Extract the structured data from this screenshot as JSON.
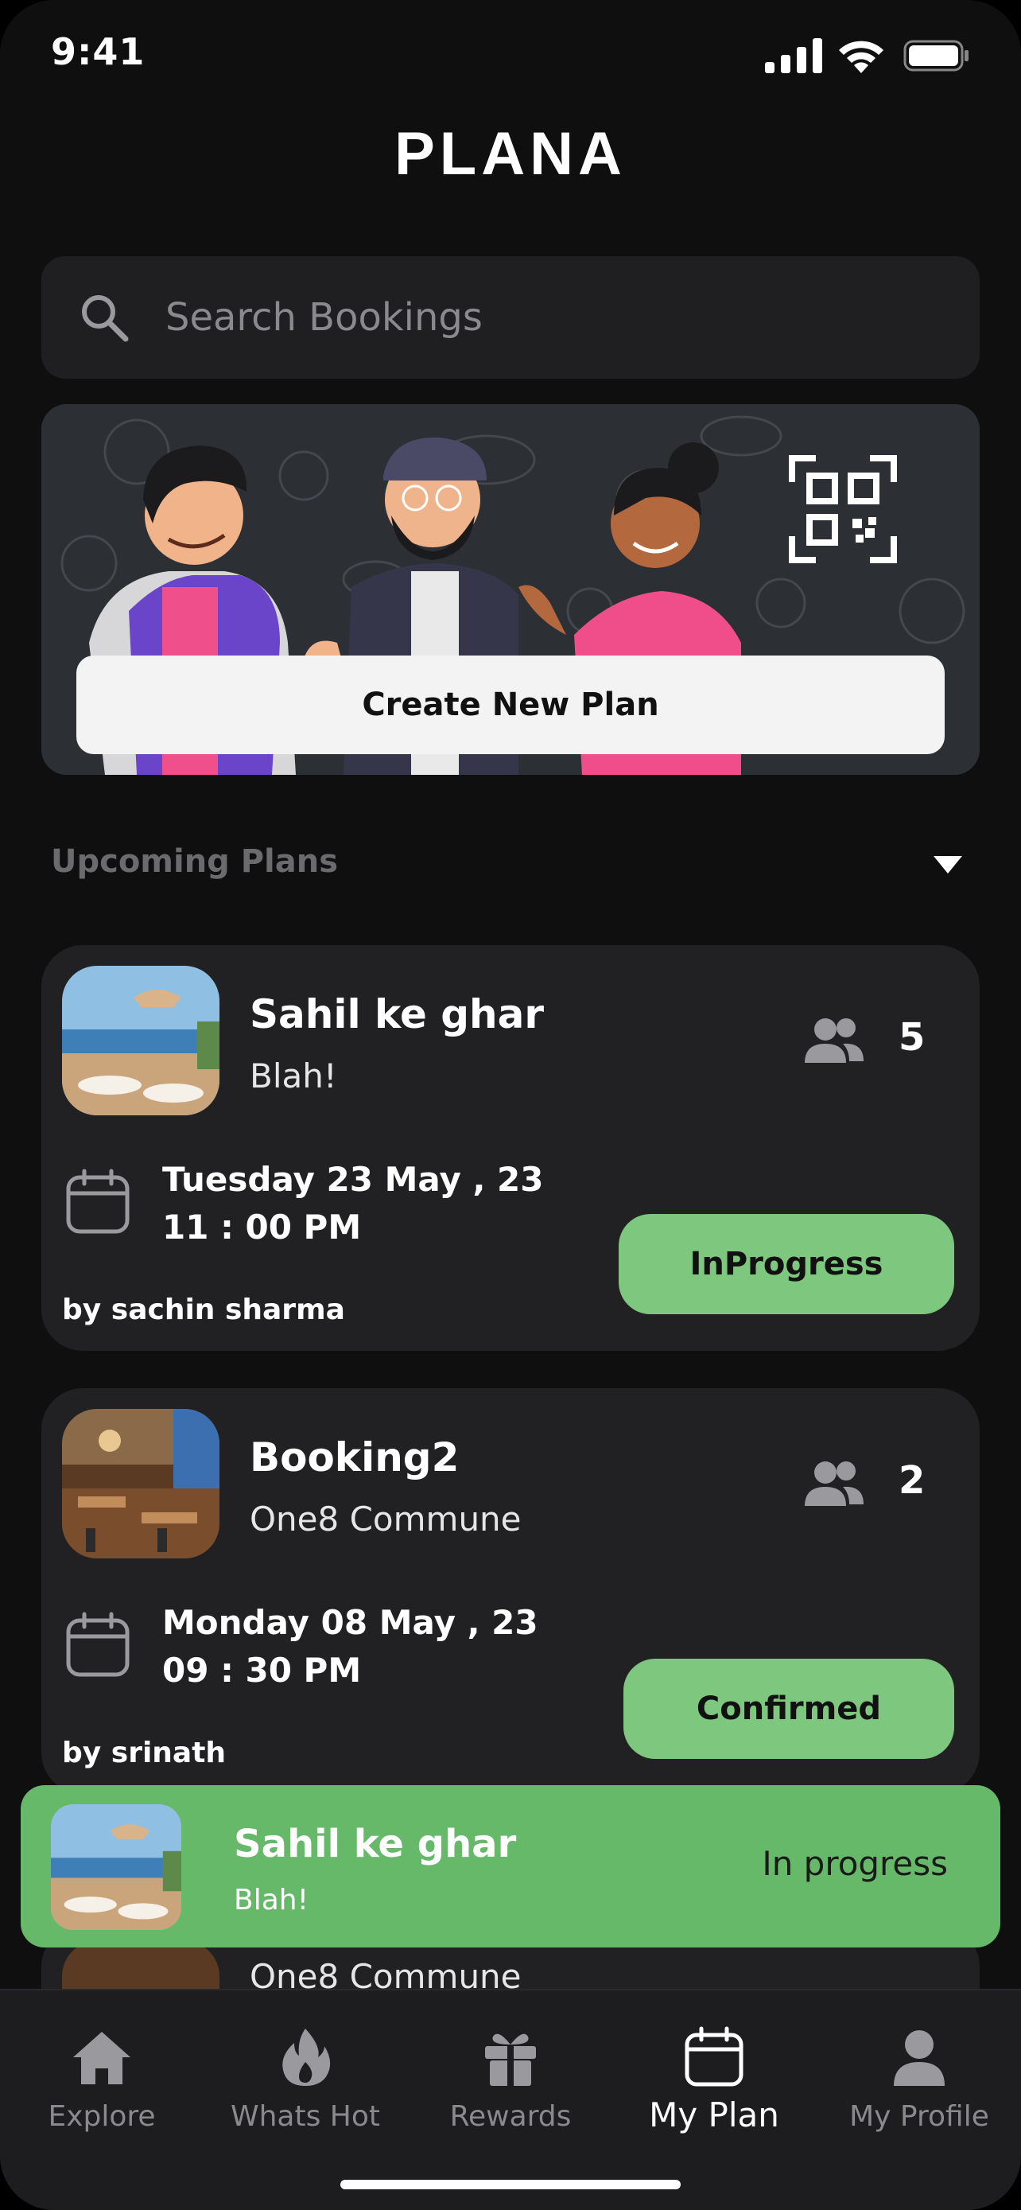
{
  "status_bar": {
    "time": "9:41"
  },
  "app": {
    "logo": "PLANA"
  },
  "search": {
    "placeholder": "Search Bookings"
  },
  "banner": {
    "button_label": "Create New Plan"
  },
  "section": {
    "title": "Upcoming Plans"
  },
  "plans": [
    {
      "title": "Sahil ke ghar",
      "subtitle": "Blah!",
      "people_count": "5",
      "date": "Tuesday 23 May , 23",
      "time": "11 : 00  PM",
      "by": "by sachin sharma",
      "status": "InProgress"
    },
    {
      "title": "Booking2",
      "subtitle": "One8 Commune",
      "people_count": "2",
      "date": "Monday 08 May , 23",
      "time": "09 : 30  PM",
      "by": "by srinath",
      "status": "Confirmed"
    },
    {
      "subtitle": "One8 Commune"
    }
  ],
  "toast": {
    "title": "Sahil ke ghar",
    "subtitle": "Blah!",
    "status": "In progress"
  },
  "tabs": [
    {
      "label": "Explore",
      "icon": "home-icon"
    },
    {
      "label": "Whats Hot",
      "icon": "flame-icon"
    },
    {
      "label": "Rewards",
      "icon": "gift-icon"
    },
    {
      "label": "My Plan",
      "icon": "calendar-icon",
      "active": true
    },
    {
      "label": "My Profile",
      "icon": "profile-icon"
    }
  ],
  "colors": {
    "accent_green": "#7dc77f",
    "toast_green": "#67b96a",
    "card_bg": "#212123",
    "bg": "#0f0f10"
  }
}
